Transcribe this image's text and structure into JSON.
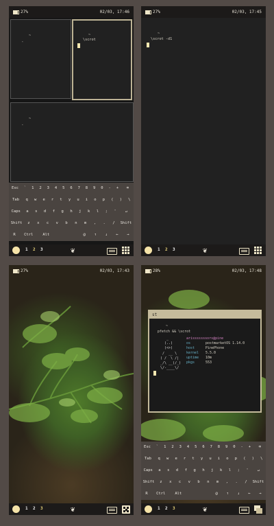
{
  "screens": [
    {
      "status": {
        "battery": "27%",
        "datetime": "02/03, 17:46"
      },
      "terminals": {
        "tile1": {
          "line1": "~",
          "line2": "‸"
        },
        "tile2": {
          "dir": "~",
          "cmd": "\\scrot"
        },
        "tile3": {
          "line1": "~",
          "line2": "‸"
        }
      },
      "keyboard": {
        "rows": [
          [
            "Esc",
            "`",
            "1",
            "2",
            "3",
            "4",
            "5",
            "6",
            "7",
            "8",
            "9",
            "0",
            "-",
            "+",
            "⌫"
          ],
          [
            "Tab",
            "q",
            "w",
            "e",
            "r",
            "t",
            "y",
            "u",
            "i",
            "o",
            "p",
            "(",
            ")",
            "\\"
          ],
          [
            "Caps",
            "a",
            "s",
            "d",
            "f",
            "g",
            "h",
            "j",
            "k",
            "l",
            ";",
            "'",
            "↵"
          ],
          [
            "Shift",
            "z",
            "x",
            "c",
            "v",
            "b",
            "n",
            "m",
            ",",
            ".",
            "/",
            "Shift"
          ],
          [
            "R",
            "Ctrl",
            "Alt",
            "",
            "@",
            "↑",
            "↓",
            "←",
            "→"
          ]
        ]
      },
      "dock": {
        "workspaces": [
          "1",
          "2",
          "3"
        ],
        "active_workspace": "2"
      }
    },
    {
      "status": {
        "battery": "27%",
        "datetime": "02/03, 17:45"
      },
      "terminal": {
        "dir": "~",
        "cmd": "\\scrot -d1"
      },
      "dock": {
        "workspaces": [
          "1",
          "2",
          "3"
        ],
        "active_workspace": "2"
      }
    },
    {
      "status": {
        "battery": "27%",
        "datetime": "02/03, 17:43"
      },
      "dock": {
        "workspaces": [
          "1",
          "2",
          "3"
        ],
        "active_workspace": "3"
      }
    },
    {
      "status": {
        "battery": "28%",
        "datetime": "02/03, 17:48"
      },
      "window": {
        "title": "st",
        "dir": "~",
        "cmd": "pfetch && \\scrot",
        "user": "arisssssssors@pine",
        "fields": [
          {
            "key": "os",
            "value": "postmarketOS 1.14.0"
          },
          {
            "key": "host",
            "value": "PinePhone"
          },
          {
            "key": "kernel",
            "value": "5.5.0"
          },
          {
            "key": "uptime",
            "value": "10m"
          },
          {
            "key": "pkgs",
            "value": "553"
          }
        ]
      },
      "keyboard": {
        "rows": [
          [
            "Esc",
            "`",
            "1",
            "2",
            "3",
            "4",
            "5",
            "6",
            "7",
            "8",
            "9",
            "0",
            "-",
            "+",
            "⌫"
          ],
          [
            "Tab",
            "q",
            "w",
            "e",
            "r",
            "t",
            "y",
            "u",
            "i",
            "o",
            "p",
            "(",
            ")",
            "\\"
          ],
          [
            "Caps",
            "a",
            "s",
            "d",
            "f",
            "g",
            "h",
            "j",
            "k",
            "l",
            ";",
            "'",
            "↵"
          ],
          [
            "Shift",
            "z",
            "x",
            "c",
            "v",
            "b",
            "n",
            "m",
            ",",
            ".",
            "/",
            "Shift"
          ],
          [
            "R",
            "Ctrl",
            "Alt",
            "",
            "@",
            "↑",
            "↓",
            "←",
            "→"
          ]
        ]
      },
      "dock": {
        "workspaces": [
          "1",
          "2",
          "3"
        ],
        "active_workspace": "3"
      }
    }
  ],
  "icons": {
    "home": "circle-icon",
    "launcher": "leaf-icon",
    "keyboard": "keyboard-icon",
    "layout": "grid-icon"
  }
}
